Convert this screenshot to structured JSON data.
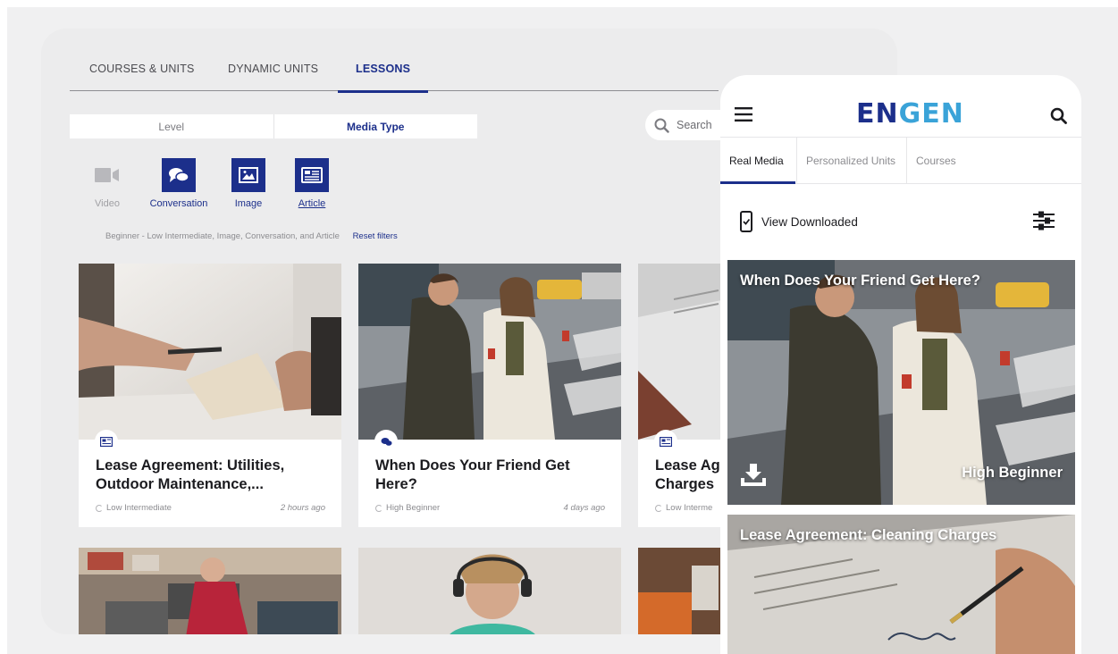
{
  "desktop": {
    "tabs": [
      "COURSES & UNITS",
      "DYNAMIC UNITS",
      "LESSONS"
    ],
    "active_tab": "LESSONS",
    "filter_segments": [
      "Level",
      "Media Type"
    ],
    "active_segment": "Media Type",
    "search": {
      "placeholder": "Search"
    },
    "media_types": [
      {
        "label": "Video",
        "icon": "video-icon",
        "selected": false
      },
      {
        "label": "Conversation",
        "icon": "conversation-icon",
        "selected": true
      },
      {
        "label": "Image",
        "icon": "image-icon",
        "selected": true
      },
      {
        "label": "Article",
        "icon": "article-icon",
        "selected": true
      }
    ],
    "filter_summary": "Beginner - Low Intermediate, Image, Conversation, and Article",
    "reset_label": "Reset filters",
    "cards": [
      {
        "title": "Lease Agreement: Utilities, Outdoor Maintenance,...",
        "level": "Low Intermediate",
        "time": "2 hours ago",
        "type_icon": "article-icon"
      },
      {
        "title": "When Does Your Friend Get Here?",
        "level": "High Beginner",
        "time": "4 days ago",
        "type_icon": "conversation-icon"
      },
      {
        "title": "Lease Ag Charges",
        "level": "Low Interme",
        "time": "",
        "type_icon": "article-icon"
      }
    ]
  },
  "mobile": {
    "logo": {
      "part1": "EN",
      "part2": "GEN"
    },
    "tabs": [
      "Real Media",
      "Personalized Units",
      "Courses"
    ],
    "active_tab": "Real Media",
    "view_downloaded": "View Downloaded",
    "cards": [
      {
        "title": "When Does Your Friend Get Here?",
        "level": "High Beginner"
      },
      {
        "title": "Lease Agreement: Cleaning Charges",
        "level": ""
      }
    ]
  },
  "colors": {
    "brand": "#1c2f8b",
    "accent": "#3aa3d8",
    "background": "#ececed"
  }
}
